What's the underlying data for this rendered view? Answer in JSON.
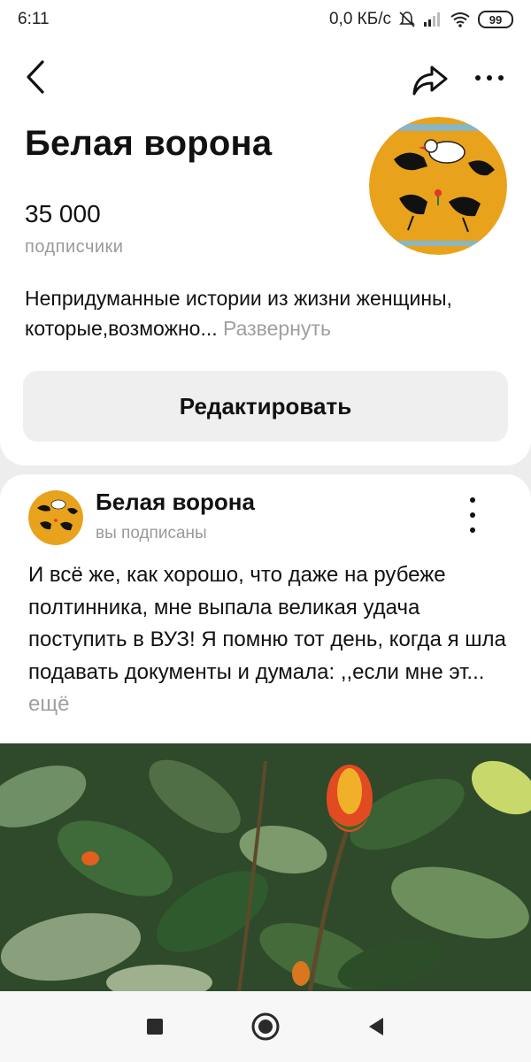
{
  "status_bar": {
    "time": "6:11",
    "network_speed": "0,0 КБ/с",
    "battery": "99"
  },
  "icons": {
    "back": "back-arrow-icon",
    "share": "share-icon",
    "more": "more-icon",
    "post_menu": "vertical-dots-icon",
    "android_recents": "square-icon",
    "android_home": "circle-icon",
    "android_back": "triangle-back-icon"
  },
  "channel": {
    "title": "Белая ворона",
    "subscribers_count": "35 000",
    "subscribers_label": "подписчики",
    "description": "Непридуманные истории из жизни женщины, которые,возможно...",
    "expand_label": "Развернуть",
    "edit_button": "Редактировать"
  },
  "post": {
    "author": "Белая ворона",
    "status": "вы подписаны",
    "text": "И всё же, как хорошо, что даже на рубеже полтинника, мне выпала великая удача поступить в ВУЗ! Я помню тот день, когда я шла подавать документы и думала: ,,если мне эт...",
    "more_label": "ещё"
  },
  "colors": {
    "accent_orange": "#e8a21c",
    "muted_text": "#9a9a9a",
    "background": "#ededed"
  }
}
